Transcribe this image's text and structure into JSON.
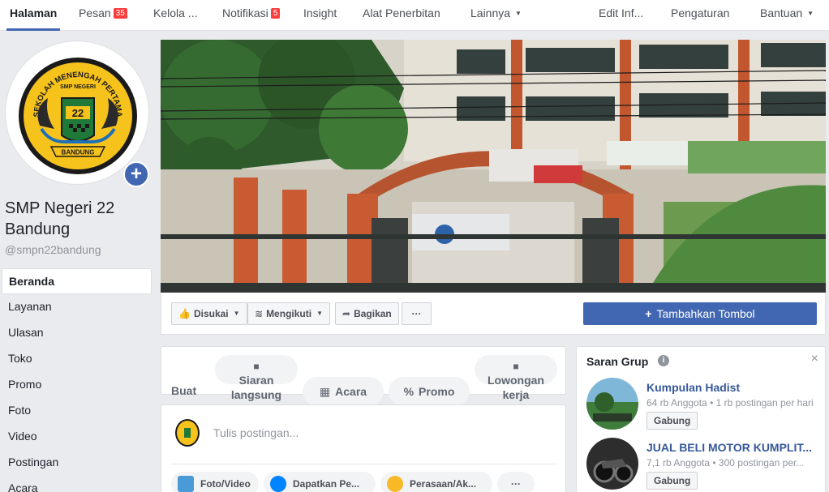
{
  "topnav": {
    "halaman": "Halaman",
    "pesan": "Pesan",
    "pesan_count": "35",
    "kelola": "Kelola ...",
    "notifikasi": "Notifikasi",
    "notifikasi_count": "5",
    "insight": "Insight",
    "alat": "Alat Penerbitan",
    "lainnya": "Lainnya",
    "edit": "Edit Inf...",
    "pengaturan": "Pengaturan",
    "bantuan": "Bantuan"
  },
  "page": {
    "name": "SMP Negeri 22 Bandung",
    "handle": "@smpn22bandung"
  },
  "leftnav": [
    "Beranda",
    "Layanan",
    "Ulasan",
    "Toko",
    "Promo",
    "Foto",
    "Video",
    "Postingan",
    "Acara"
  ],
  "actions": {
    "liked": "Disukai",
    "following": "Mengikuti",
    "share": "Bagikan",
    "more": "···",
    "add_button": "Tambahkan Tombol"
  },
  "create": {
    "label": "Buat",
    "live": "Siaran langsung",
    "event": "Acara",
    "promo": "Promo",
    "job": "Lowongan kerja"
  },
  "composer": {
    "placeholder": "Tulis postingan...",
    "chips": [
      "Foto/Video",
      "Dapatkan Pe...",
      "Perasaan/Ak...",
      "···"
    ]
  },
  "suggest": {
    "title": "Saran Grup",
    "close": "×",
    "groups": [
      {
        "name": "Kumpulan Hadist",
        "meta": "64 rb Anggota • 1 rb postingan per hari",
        "join": "Gabung"
      },
      {
        "name": "JUAL BELI MOTOR KUMPLIT...",
        "meta": "7,1 rb Anggota • 300 postingan per...",
        "join": "Gabung"
      }
    ]
  },
  "logo_text": {
    "arc": "SEKOLAH MENENGAH PERTAMA",
    "top": "SMP NEGERI",
    "num": "22",
    "bottom": "BANDUNG"
  },
  "colors": {
    "brand": "#4267b2",
    "badge": "#fa3e3e",
    "link": "#365899"
  }
}
